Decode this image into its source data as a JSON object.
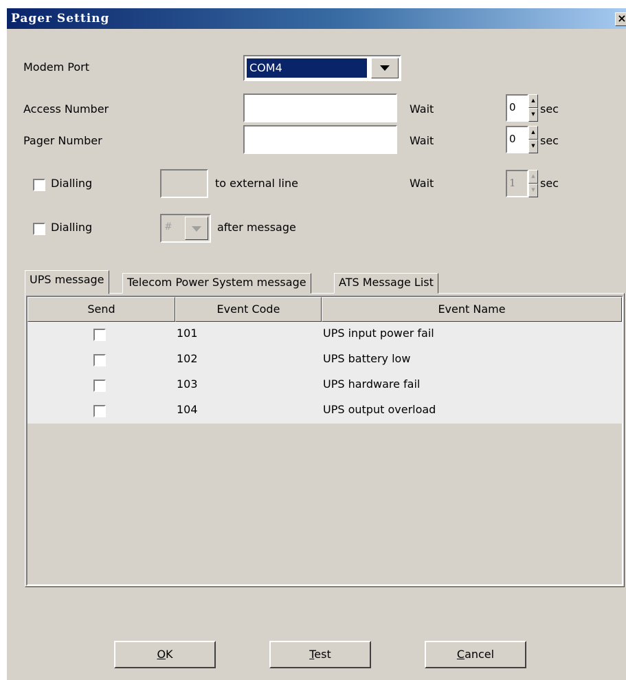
{
  "window": {
    "title": "Pager Setting",
    "close_glyph": "×"
  },
  "modem": {
    "label": "Modem Port",
    "value": "COM4"
  },
  "access": {
    "label": "Access Number",
    "value": "",
    "wait_label": "Wait",
    "wait_value": "0",
    "sec_label": "sec"
  },
  "pager": {
    "label": "Pager Number",
    "value": "",
    "wait_label": "Wait",
    "wait_value": "0",
    "sec_label": "sec"
  },
  "dial_external": {
    "label": "Dialling",
    "value": "",
    "suffix": "to external line",
    "wait_label": "Wait",
    "wait_value": "1",
    "sec_label": "sec"
  },
  "dial_after": {
    "label": "Dialling",
    "value": "#",
    "suffix": "after message"
  },
  "tabs": [
    {
      "label": "UPS message",
      "active": true
    },
    {
      "label": "Telecom Power System message",
      "active": false
    },
    {
      "label": "ATS Message List",
      "active": false
    }
  ],
  "table": {
    "headers": [
      "Send",
      "Event Code",
      "Event Name"
    ],
    "rows": [
      {
        "code": "101",
        "name": "UPS input power fail"
      },
      {
        "code": "102",
        "name": "UPS battery low"
      },
      {
        "code": "103",
        "name": "UPS hardware fail"
      },
      {
        "code": "104",
        "name": "UPS output overload"
      }
    ]
  },
  "buttons": {
    "ok": {
      "mnemonic": "O",
      "rest": "K"
    },
    "test": {
      "mnemonic": "T",
      "rest": "est"
    },
    "cancel": {
      "mnemonic": "C",
      "rest": "ancel"
    }
  }
}
